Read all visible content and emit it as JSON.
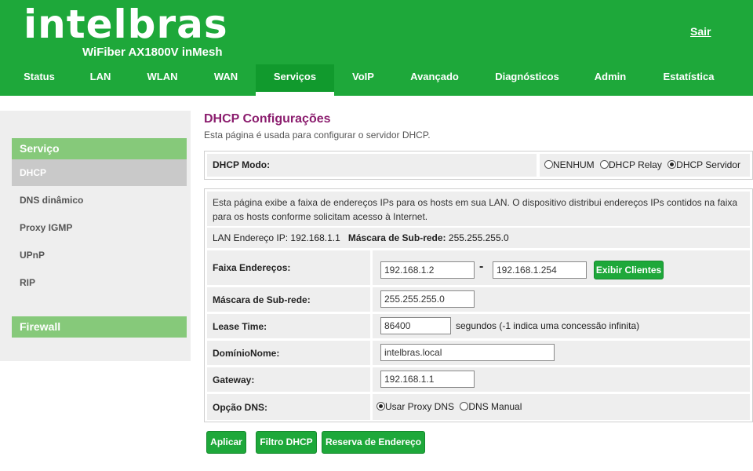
{
  "header": {
    "brand": "intelbras",
    "model": "WiFiber AX1800V inMesh",
    "logout": "Sair"
  },
  "nav": {
    "items": [
      {
        "label": "Status"
      },
      {
        "label": "LAN"
      },
      {
        "label": "WLAN"
      },
      {
        "label": "WAN"
      },
      {
        "label": "Serviços",
        "active": true
      },
      {
        "label": "VoIP"
      },
      {
        "label": "Avançado"
      },
      {
        "label": "Diagnósticos"
      },
      {
        "label": "Admin"
      },
      {
        "label": "Estatística"
      }
    ]
  },
  "sidebar": {
    "category_service": "Serviço",
    "items": [
      {
        "label": "DHCP",
        "active": true
      },
      {
        "label": "DNS dinâmico"
      },
      {
        "label": "Proxy IGMP"
      },
      {
        "label": "UPnP"
      },
      {
        "label": "RIP"
      }
    ],
    "category_firewall": "Firewall"
  },
  "page": {
    "title": "DHCP Configurações",
    "description": "Esta página é usada para configurar o servidor DHCP."
  },
  "mode": {
    "label": "DHCP Modo:",
    "options": [
      "NENHUM",
      "DHCP Relay",
      "DHCP Servidor"
    ],
    "selected": "DHCP Servidor"
  },
  "info": {
    "line1": "Esta página exibe a faixa de endereços IPs para os hosts em sua LAN. O dispositivo distribui endereços IPs contidos na faixa",
    "line2": "para os hosts conforme solicitam acesso à Internet."
  },
  "lan": {
    "ip_label": "LAN Endereço IP:",
    "ip_value": "192.168.1.1",
    "mask_label": "Máscara de Sub-rede:",
    "mask_value": "255.255.255.0"
  },
  "form": {
    "range_label": "Faixa Endereços:",
    "range_start": "192.168.1.2",
    "range_sep": "-",
    "range_end": "192.168.1.254",
    "show_clients": "Exibir Clientes",
    "mask_label": "Máscara de Sub-rede:",
    "mask_value": "255.255.255.0",
    "lease_label": "Lease Time:",
    "lease_value": "86400",
    "lease_hint": "segundos (-1 indica uma concessão infinita)",
    "domain_label": "DomínioNome:",
    "domain_value": "intelbras.local",
    "gateway_label": "Gateway:",
    "gateway_value": "192.168.1.1",
    "dns_label": "Opção DNS:",
    "dns_options": [
      "Usar Proxy DNS",
      "DNS Manual"
    ],
    "dns_selected": "Usar Proxy DNS"
  },
  "actions": {
    "apply": "Aplicar",
    "filter": "Filtro DHCP",
    "reserve": "Reserva de Endereço"
  },
  "colors": {
    "brand_green": "#1ea83a",
    "title_purple": "#8b1d6e",
    "sidebar_green": "#86c97a"
  }
}
